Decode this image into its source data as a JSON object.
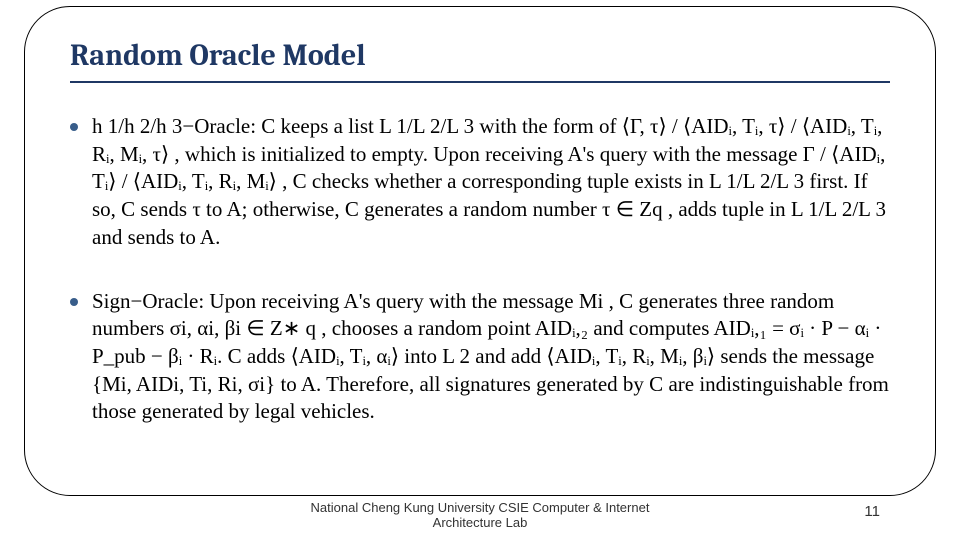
{
  "title": "Random Oracle Model",
  "bullets": [
    {
      "text": "h 1/h 2/h 3−Oracle: C keeps a list L 1/L 2/L 3 with the form of ⟨Γ, τ⟩ / ⟨AIDᵢ, Tᵢ, τ⟩ / ⟨AIDᵢ, Tᵢ, Rᵢ, Mᵢ, τ⟩ , which is initialized to empty. Upon receiving A's query with the message Γ / ⟨AIDᵢ, Tᵢ⟩ / ⟨AIDᵢ, Tᵢ, Rᵢ, Mᵢ⟩ , C checks whether a corresponding tuple exists in L 1/L 2/L 3 first. If so, C sends τ to A; otherwise, C generates a random number τ ∈ Zq , adds tuple in L 1/L 2/L 3 and sends to A."
    },
    {
      "text": "Sign−Oracle: Upon receiving A's query with the message Mi , C generates three random numbers σi, αi, βi ∈ Z∗ q , chooses a random point AIDᵢ,₂ and computes AIDᵢ,₁ = σᵢ · P − αᵢ · P_pub − βᵢ · Rᵢ.  C adds ⟨AIDᵢ, Tᵢ, αᵢ⟩ into L 2 and add ⟨AIDᵢ, Tᵢ, Rᵢ, Mᵢ, βᵢ⟩ sends the message {Mi, AIDi, Ti, Ri, σi} to A. Therefore, all signatures generated by C are indistinguishable from those generated by legal vehicles."
    }
  ],
  "footer": {
    "line1": "National Cheng Kung University CSIE Computer & Internet",
    "line2": "Architecture Lab"
  },
  "page_number": "11"
}
